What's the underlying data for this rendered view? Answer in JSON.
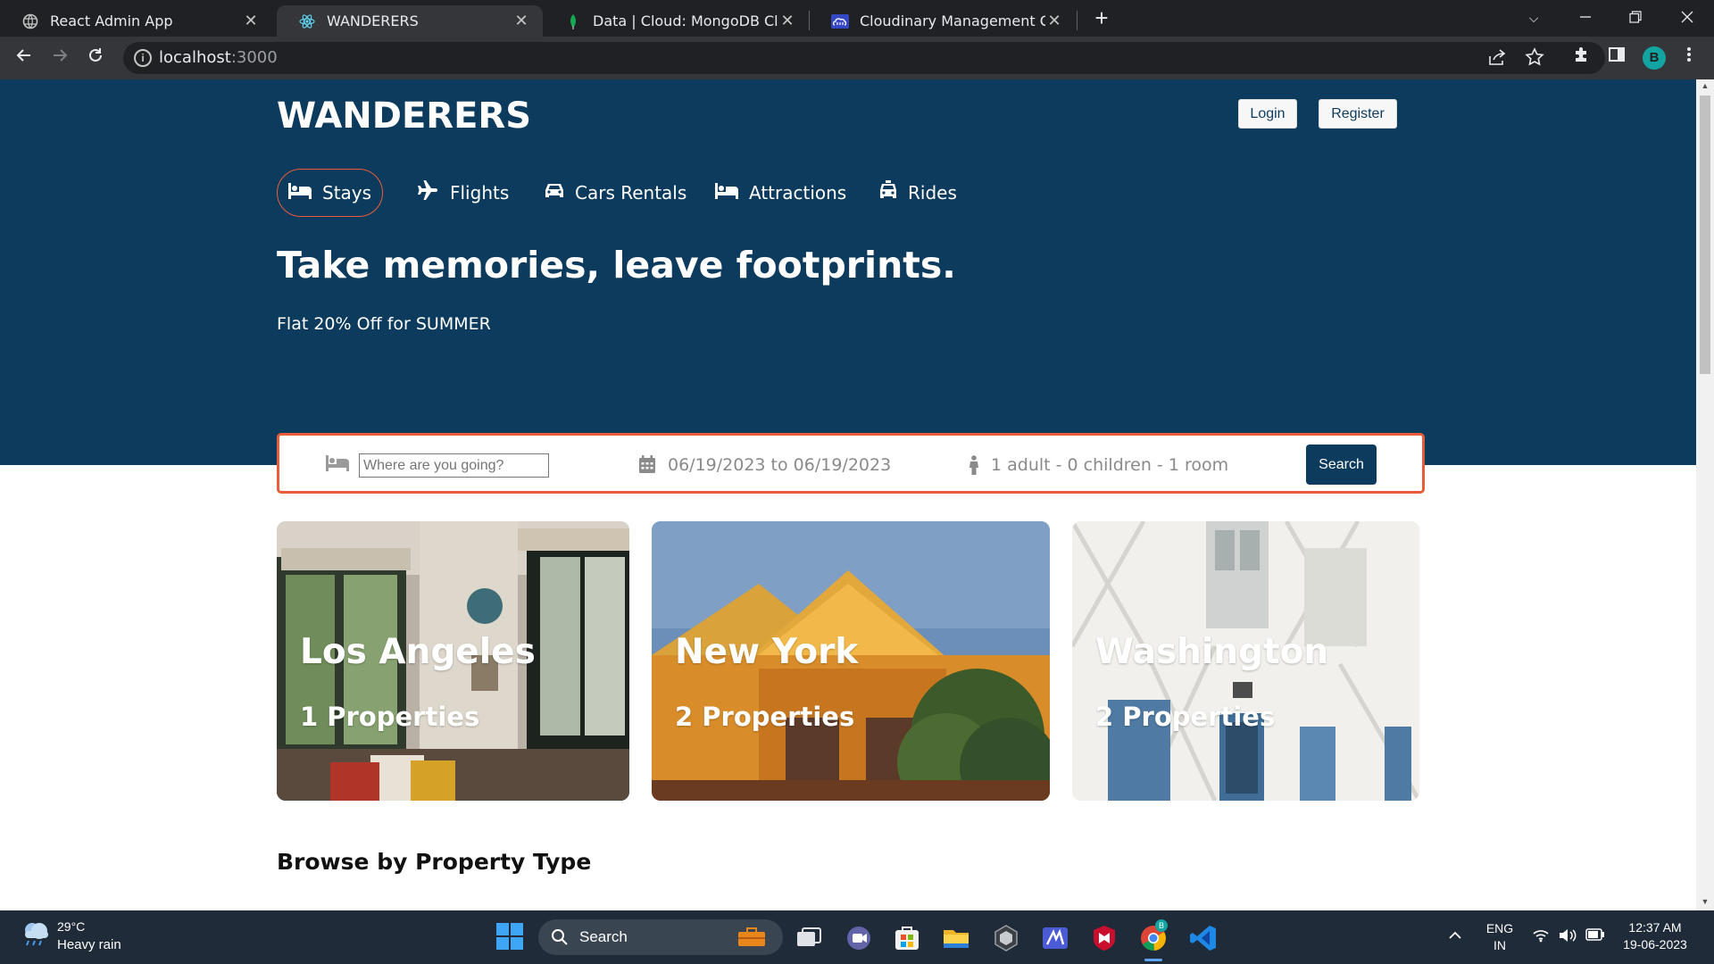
{
  "browser": {
    "tabs": [
      {
        "title": "React Admin App",
        "icon": "globe-icon"
      },
      {
        "title": "WANDERERS",
        "icon": "react-icon",
        "active": true
      },
      {
        "title": "Data | Cloud: MongoDB Cloud",
        "icon": "mongodb-leaf-icon"
      },
      {
        "title": "Cloudinary Management Console",
        "icon": "cloudinary-icon"
      }
    ],
    "url_host": "localhost",
    "url_port": ":3000",
    "profile_initial": "B"
  },
  "site": {
    "brand": "WANDERERS",
    "login_label": "Login",
    "register_label": "Register",
    "nav": [
      {
        "label": "Stays",
        "icon": "bed-icon",
        "active": true
      },
      {
        "label": "Flights",
        "icon": "plane-icon"
      },
      {
        "label": "Cars Rentals",
        "icon": "car-icon"
      },
      {
        "label": "Attractions",
        "icon": "bed-icon"
      },
      {
        "label": "Rides",
        "icon": "taxi-icon"
      }
    ],
    "headline": "Take memories, leave footprints.",
    "subheadline": "Flat 20% Off for SUMMER"
  },
  "search": {
    "destination_placeholder": "Where are you going?",
    "dates": "06/19/2023 to 06/19/2023",
    "guests": "1 adult - 0 children - 1 room",
    "button_label": "Search"
  },
  "featured": [
    {
      "city": "Los Angeles",
      "count": "1 Properties"
    },
    {
      "city": "New York",
      "count": "2 Properties"
    },
    {
      "city": "Washington",
      "count": "2 Properties"
    }
  ],
  "sections": {
    "browse_title": "Browse by Property Type"
  },
  "taskbar": {
    "temperature": "29°C",
    "weather": "Heavy rain",
    "search_label": "Search",
    "lang_top": "ENG",
    "lang_bottom": "IN",
    "time": "12:37 AM",
    "date": "19-06-2023"
  },
  "colors": {
    "brand_navy": "#0d3b5e",
    "accent_orange": "#e85c3a",
    "chrome_dark": "#202124",
    "taskbar": "#1f2b38"
  }
}
